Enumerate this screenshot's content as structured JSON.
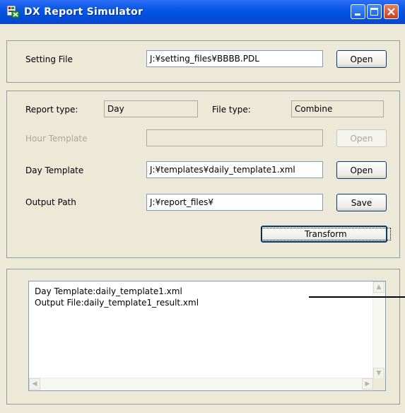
{
  "window": {
    "title": "DX Report Simulator"
  },
  "setting": {
    "label": "Setting File",
    "value": "J:¥setting_files¥BBBB.PDL",
    "open_label": "Open"
  },
  "report": {
    "report_type_label": "Report type:",
    "report_type_value": "Day",
    "file_type_label": "File type:",
    "file_type_value": "Combine",
    "hour_template_label": "Hour Template",
    "hour_template_value": "",
    "hour_open_label": "Open",
    "day_template_label": "Day Template",
    "day_template_value": "J:¥templates¥daily_template1.xml",
    "day_open_label": "Open",
    "output_path_label": "Output Path",
    "output_path_value": "J:¥report_files¥",
    "save_label": "Save",
    "transform_label": "Transform"
  },
  "log": {
    "lines": [
      "Day Template:daily_template1.xml",
      "Output File:daily_template1_result.xml"
    ]
  },
  "icons": [
    "app-icon",
    "minimize-icon",
    "maximize-icon",
    "close-icon",
    "scroll-up-icon",
    "scroll-down-icon",
    "scroll-left-icon",
    "scroll-right-icon"
  ]
}
